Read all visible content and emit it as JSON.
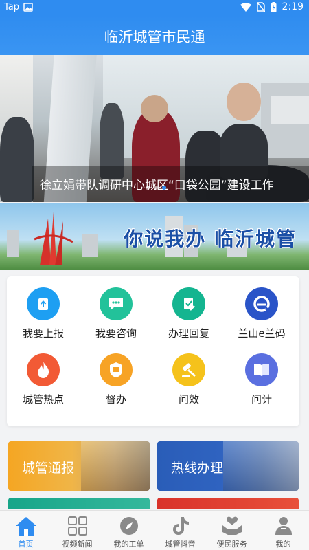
{
  "status_bar": {
    "app_label": "Tap",
    "time": "2:19"
  },
  "header": {
    "title": "临沂城管市民通"
  },
  "hero": {
    "caption": "徐立娟带队调研中心城区“口袋公园”建设工作"
  },
  "banner": {
    "slogan": "你说我办  临沂城管"
  },
  "services": [
    {
      "label": "我要上报",
      "icon": "upload-report-icon",
      "color": "#1e9ff2"
    },
    {
      "label": "我要咨询",
      "icon": "chat-bubble-icon",
      "color": "#22c29a"
    },
    {
      "label": "办理回复",
      "icon": "document-check-icon",
      "color": "#14b590"
    },
    {
      "label": "兰山e兰码",
      "icon": "e-code-icon",
      "color": "#2a54c8"
    },
    {
      "label": "城管热点",
      "icon": "flame-icon",
      "color": "#f25a35"
    },
    {
      "label": "督办",
      "icon": "supervise-seal-icon",
      "color": "#f7a325"
    },
    {
      "label": "问效",
      "icon": "gavel-icon",
      "color": "#f5c21b"
    },
    {
      "label": "问计",
      "icon": "open-book-icon",
      "color": "#5a6fe0"
    }
  ],
  "tiles": {
    "report": {
      "label": "城管通报",
      "color": "#f5a623"
    },
    "hotline": {
      "label": "热线办理",
      "color": "#2a5db8"
    }
  },
  "tabbar": [
    {
      "label": "首页",
      "icon": "home-icon",
      "active": true
    },
    {
      "label": "视频新闻",
      "icon": "grid-icon",
      "active": false
    },
    {
      "label": "我的工单",
      "icon": "compass-icon",
      "active": false
    },
    {
      "label": "城管抖音",
      "icon": "tiktok-icon",
      "active": false
    },
    {
      "label": "便民服务",
      "icon": "heart-hands-icon",
      "active": false
    },
    {
      "label": "我的",
      "icon": "person-icon",
      "active": false
    }
  ]
}
